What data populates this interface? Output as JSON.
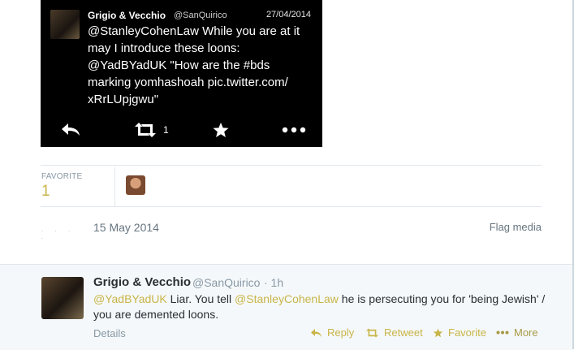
{
  "embedded_tweet": {
    "name": "Grigio & Vecchio",
    "handle": "@SanQuirico",
    "date": "27/04/2014",
    "text": "@StanleyCohenLaw While you are at it\nmay I introduce these loons:\n@YadBYadUK \"How are the #bds\nmarking yomhashoah pic.twitter.com/\nxRrLUpjgwu\"",
    "retweet_count": "1",
    "icons": [
      "reply-icon",
      "retweet-icon",
      "favorite-icon",
      "more-icon"
    ]
  },
  "stats": {
    "favorite_label": "FAVORITE",
    "favorite_count": "1"
  },
  "meta": {
    "blurred_time": ". . . .",
    "date": "15 May 2014",
    "flag_media": "Flag media"
  },
  "reply_tweet": {
    "name": "Grigio & Vecchio",
    "handle": "@SanQuirico",
    "time": "· 1h",
    "mention1": "@YadBYadUK",
    "text1": " Liar. You tell ",
    "mention2": "@StanleyCohenLaw",
    "text2": " he is persecuting you for 'being Jewish' / you are demented loons.",
    "details": "Details",
    "actions": {
      "reply": "Reply",
      "retweet": "Retweet",
      "favorite": "Favorite",
      "more": "More"
    }
  },
  "colors": {
    "accent": "#c8b548",
    "muted": "#8899a6",
    "reply_bg": "#f5f8fa"
  }
}
